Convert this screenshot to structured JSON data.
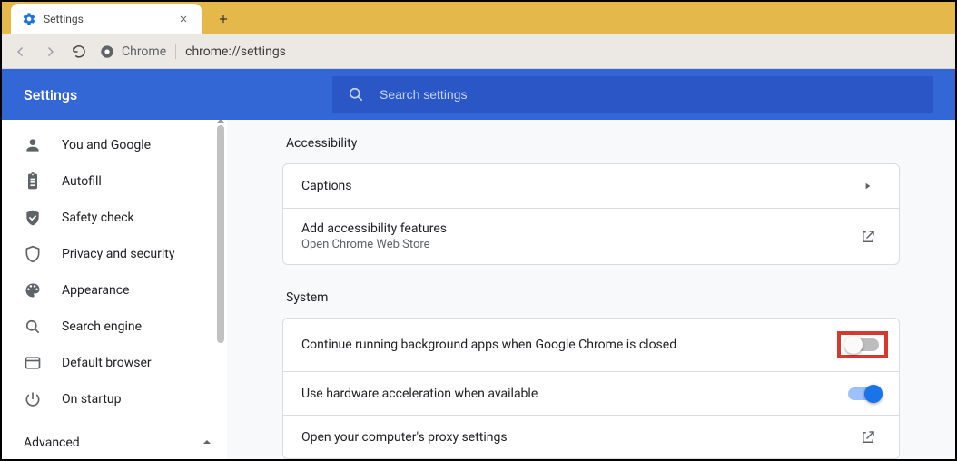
{
  "tab": {
    "title": "Settings"
  },
  "addressbar": {
    "site_label": "Chrome",
    "url": "chrome://settings"
  },
  "header": {
    "title": "Settings"
  },
  "search": {
    "placeholder": "Search settings"
  },
  "sidebar": {
    "items": [
      {
        "icon": "person-icon",
        "label": "You and Google"
      },
      {
        "icon": "clipboard-icon",
        "label": "Autofill"
      },
      {
        "icon": "shield-check-icon",
        "label": "Safety check"
      },
      {
        "icon": "shield-icon",
        "label": "Privacy and security"
      },
      {
        "icon": "palette-icon",
        "label": "Appearance"
      },
      {
        "icon": "search-icon",
        "label": "Search engine"
      },
      {
        "icon": "browser-icon",
        "label": "Default browser"
      },
      {
        "icon": "power-icon",
        "label": "On startup"
      }
    ],
    "advanced_label": "Advanced"
  },
  "sections": {
    "accessibility": {
      "title": "Accessibility",
      "rows": {
        "captions": {
          "label": "Captions"
        },
        "add_features": {
          "label": "Add accessibility features",
          "sublabel": "Open Chrome Web Store"
        }
      }
    },
    "system": {
      "title": "System",
      "rows": {
        "background_apps": {
          "label": "Continue running background apps when Google Chrome is closed",
          "toggle": "off"
        },
        "hw_accel": {
          "label": "Use hardware acceleration when available",
          "toggle": "on"
        },
        "proxy": {
          "label": "Open your computer's proxy settings"
        }
      }
    }
  }
}
